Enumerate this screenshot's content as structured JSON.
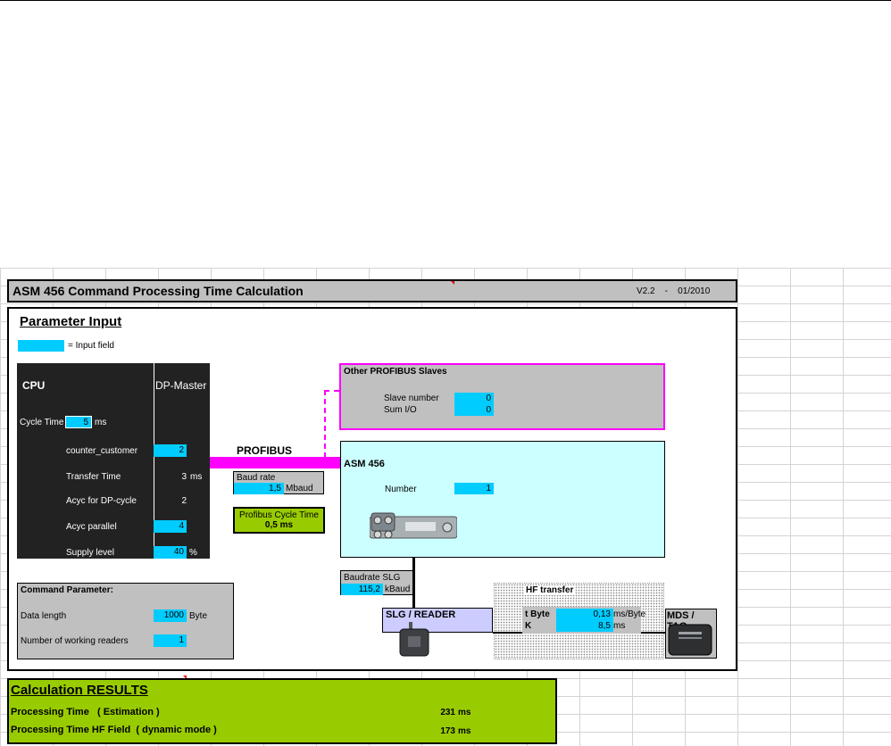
{
  "header": {
    "title": "ASM 456 Command Processing Time Calculation",
    "version": "V2.2    -    01/2010"
  },
  "parameter_input": {
    "title": "Parameter Input",
    "legend": "= Input field"
  },
  "cpu": {
    "title": "CPU",
    "dp_master": "DP-Master",
    "cycle_time_label": "Cycle Time",
    "cycle_time_value": "5",
    "cycle_time_unit": "ms",
    "rows": [
      {
        "label": "counter_customer",
        "value": "2",
        "unit": "",
        "input": true
      },
      {
        "label": "Transfer Time",
        "value": "3",
        "unit": "ms",
        "input": false
      },
      {
        "label": "Acyc for DP-cycle",
        "value": "2",
        "unit": "",
        "input": false
      },
      {
        "label": "Acyc parallel",
        "value": "4",
        "unit": "",
        "input": true
      },
      {
        "label": "Supply level",
        "value": "40",
        "unit": "%",
        "input": true
      }
    ]
  },
  "profibus": {
    "label": "PROFIBUS",
    "baud_rate_label": "Baud rate",
    "baud_rate_value": "1,5",
    "baud_rate_unit": "Mbaud",
    "cycle_time_label": "Profibus Cycle Time",
    "cycle_time_value": "0,5 ms"
  },
  "other_slaves": {
    "title": "Other PROFIBUS Slaves",
    "slave_number_label": "Slave number",
    "slave_number_value": "0",
    "sum_io_label": "Sum I/O",
    "sum_io_value": "0"
  },
  "asm": {
    "title": "ASM 456",
    "number_label": "Number",
    "number_value": "1"
  },
  "slg": {
    "baudrate_label": "Baudrate SLG",
    "baudrate_value": "115,2",
    "baudrate_unit": "kBaud",
    "title": "SLG / READER"
  },
  "hf": {
    "title": "HF transfer",
    "byte_label": "t Byte",
    "byte_value": "0,13",
    "byte_unit": "ms/Byte",
    "k_label": "K",
    "k_value": "8,5",
    "k_unit": "ms"
  },
  "mds": {
    "title": "MDS / TAG"
  },
  "command_parameter": {
    "title": "Command Parameter:",
    "data_length_label": "Data length",
    "data_length_value": "1000",
    "data_length_unit": "Byte",
    "readers_label": "Number of working readers",
    "readers_value": "1"
  },
  "results": {
    "title": "Calculation RESULTS",
    "processing_label": "Processing Time   ( Estimation )",
    "processing_value": "231",
    "processing_unit": "ms",
    "hf_label": "Processing Time HF Field  ( dynamic mode )",
    "hf_value": "173",
    "hf_unit": "ms"
  },
  "colors": {
    "input": "#00ccff",
    "profibus": "#ff00ff",
    "results": "#99cc00",
    "asm": "#ccffff",
    "slg": "#ccccff"
  }
}
